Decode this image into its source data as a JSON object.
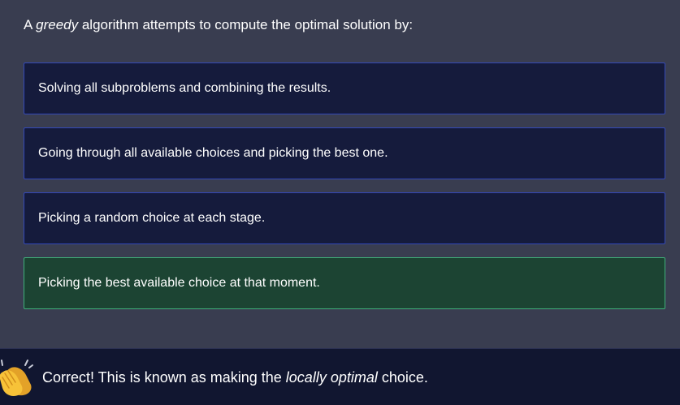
{
  "question": {
    "prefix": "A ",
    "emphasis": "greedy",
    "suffix": " algorithm attempts to compute the optimal solution by:"
  },
  "options": [
    {
      "label": "Solving all subproblems and combining the results.",
      "state": "default"
    },
    {
      "label": "Going through all available choices and picking the best one.",
      "state": "default"
    },
    {
      "label": "Picking a random choice at each stage.",
      "state": "default"
    },
    {
      "label": "Picking the best available choice at that moment.",
      "state": "correct"
    }
  ],
  "feedback": {
    "icon": "clapping-hands-icon",
    "prefix": "Correct! This is known as making the ",
    "emphasis": "locally optimal",
    "suffix": " choice."
  },
  "colors": {
    "background": "#393d50",
    "option_bg": "#151b3c",
    "option_border": "#3348b8",
    "correct_bg": "#1c4433",
    "correct_border": "#3fb07a",
    "feedback_bg": "#111630"
  }
}
